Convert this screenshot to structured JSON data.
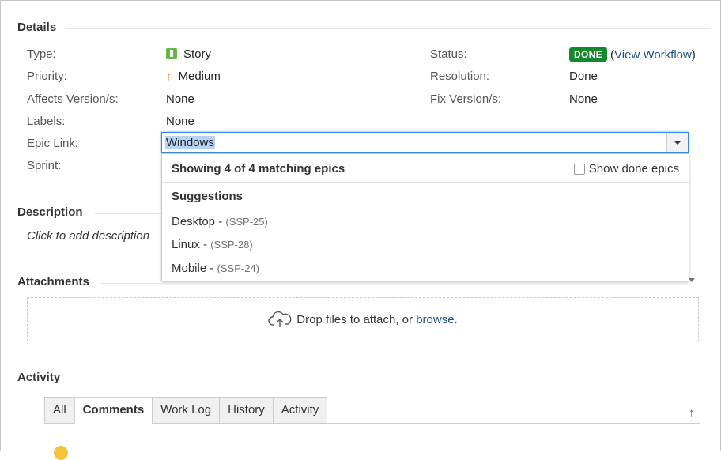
{
  "details": {
    "title": "Details",
    "left_fields": [
      {
        "label": "Type:",
        "value": "Story"
      },
      {
        "label": "Priority:",
        "value": "Medium"
      },
      {
        "label": "Affects Version/s:",
        "value": "None"
      },
      {
        "label": "Labels:",
        "value": "None"
      },
      {
        "label": "Epic Link:",
        "value": "Windows"
      },
      {
        "label": "Sprint:",
        "value": ""
      }
    ],
    "right_fields": [
      {
        "label": "Status:",
        "value": "DONE",
        "link": "View Workflow"
      },
      {
        "label": "Resolution:",
        "value": "Done"
      },
      {
        "label": "Fix Version/s:",
        "value": "None"
      }
    ]
  },
  "epic_dropdown": {
    "header": "Showing 4 of 4 matching epics",
    "show_done_label": "Show done epics",
    "suggestions_label": "Suggestions",
    "items": [
      {
        "name": "Desktop - ",
        "key": "(SSP-25)"
      },
      {
        "name": "Linux - ",
        "key": "(SSP-28)"
      },
      {
        "name": "Mobile - ",
        "key": "(SSP-24)"
      }
    ]
  },
  "description": {
    "title": "Description",
    "placeholder": "Click to add description"
  },
  "attachments": {
    "title": "Attachments",
    "drop_text": "Drop files to attach, or ",
    "browse_link": "browse",
    "drop_suffix": "."
  },
  "activity": {
    "title": "Activity",
    "tabs": [
      "All",
      "Comments",
      "Work Log",
      "History",
      "Activity"
    ],
    "active_tab": "Comments"
  },
  "colors": {
    "status_done": "#14892c",
    "link": "#205081",
    "story_icon": "#63ba3c",
    "priority_medium": "#e8731c",
    "focus_border": "#3b86d8"
  },
  "icons": [
    "story-icon",
    "priority-medium-icon",
    "dropdown-arrow-icon",
    "cloud-upload-icon",
    "scroll-top-icon"
  ]
}
